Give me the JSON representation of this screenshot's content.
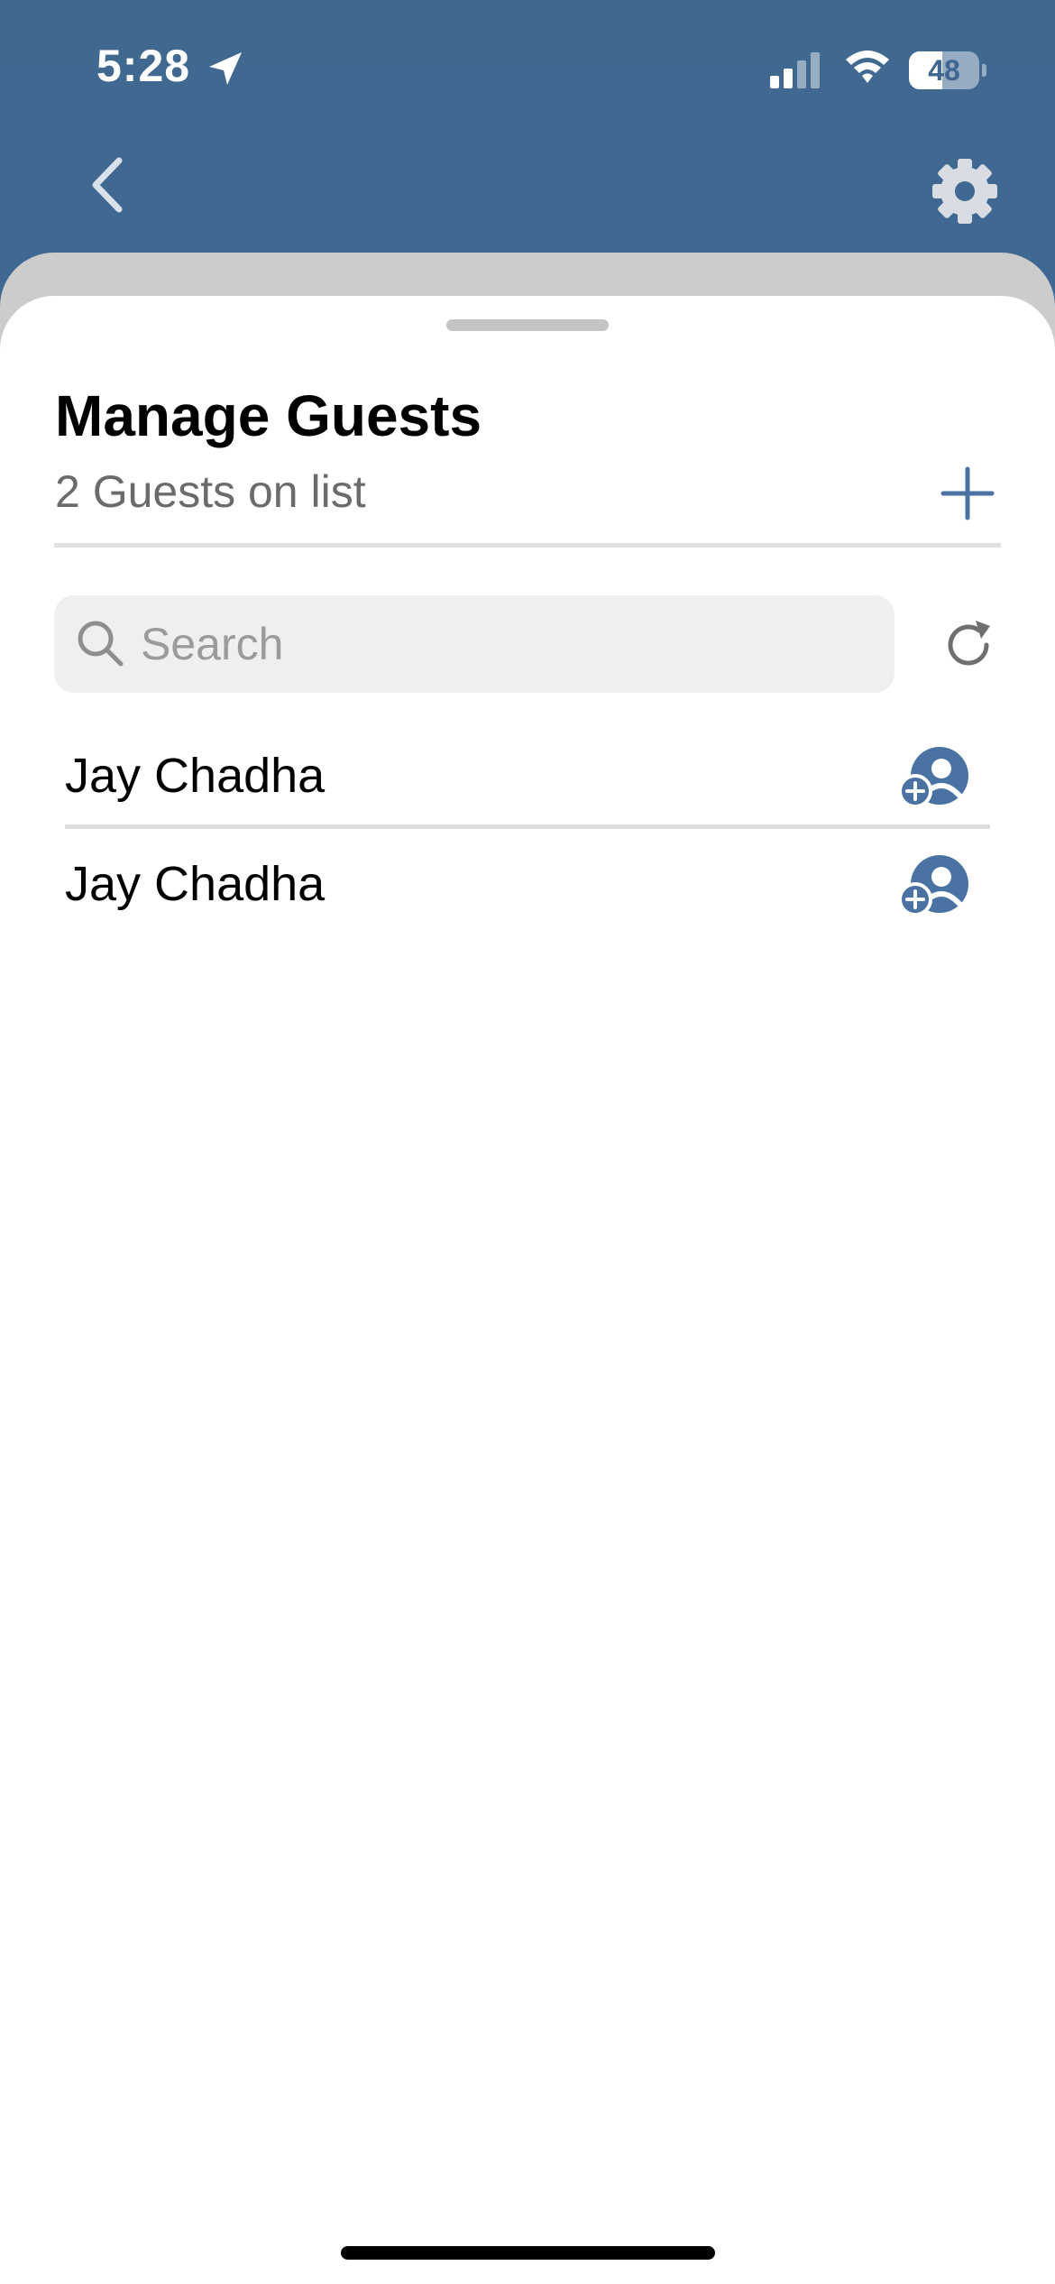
{
  "status_bar": {
    "time": "5:28",
    "battery_level": "48",
    "location_icon": "location-arrow-icon",
    "signal_icon": "cellular-signal-icon",
    "wifi_icon": "wifi-icon"
  },
  "nav": {
    "back_icon": "chevron-left-icon",
    "settings_icon": "gear-icon"
  },
  "sheet": {
    "title": "Manage Guests",
    "guest_count_text": "2 Guests on list",
    "add_icon": "plus-icon",
    "search": {
      "placeholder": "Search",
      "value": ""
    },
    "refresh_icon": "refresh-icon",
    "guests": [
      {
        "name": "Jay Chadha",
        "action_icon": "add-person-icon"
      },
      {
        "name": "Jay Chadha",
        "action_icon": "add-person-icon"
      }
    ]
  },
  "colors": {
    "header_blue": "#3f6691",
    "accent_blue": "#4a72a3",
    "sheet_background": "#ffffff"
  }
}
